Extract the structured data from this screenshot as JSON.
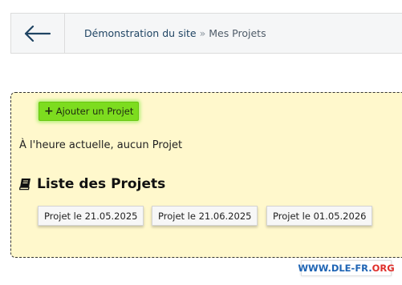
{
  "breadcrumb": {
    "link": "Démonstration du site",
    "separator": " » ",
    "current": "Mes Projets"
  },
  "actions": {
    "add_project_label": "Ajouter un Projet"
  },
  "status": {
    "text": "À l'heure actuelle, aucun Projet"
  },
  "projects": {
    "title": "Liste des Projets",
    "items": [
      {
        "label": "Projet le 21.05.2025"
      },
      {
        "label": "Projet le 21.06.2025"
      },
      {
        "label": "Projet le 01.05.2026"
      }
    ]
  },
  "watermark": {
    "main": "WWW.DLE-FR.",
    "suffix": "ORG"
  },
  "icons": {
    "back": "arrow-left-icon",
    "add": "plus-icon",
    "list": "book-icon"
  },
  "colors": {
    "panel_bg": "#fff8cc",
    "add_button": "#7ddc1f",
    "link": "#1f4463",
    "watermark_blue": "#1e64b4",
    "watermark_red": "#e0302c"
  }
}
